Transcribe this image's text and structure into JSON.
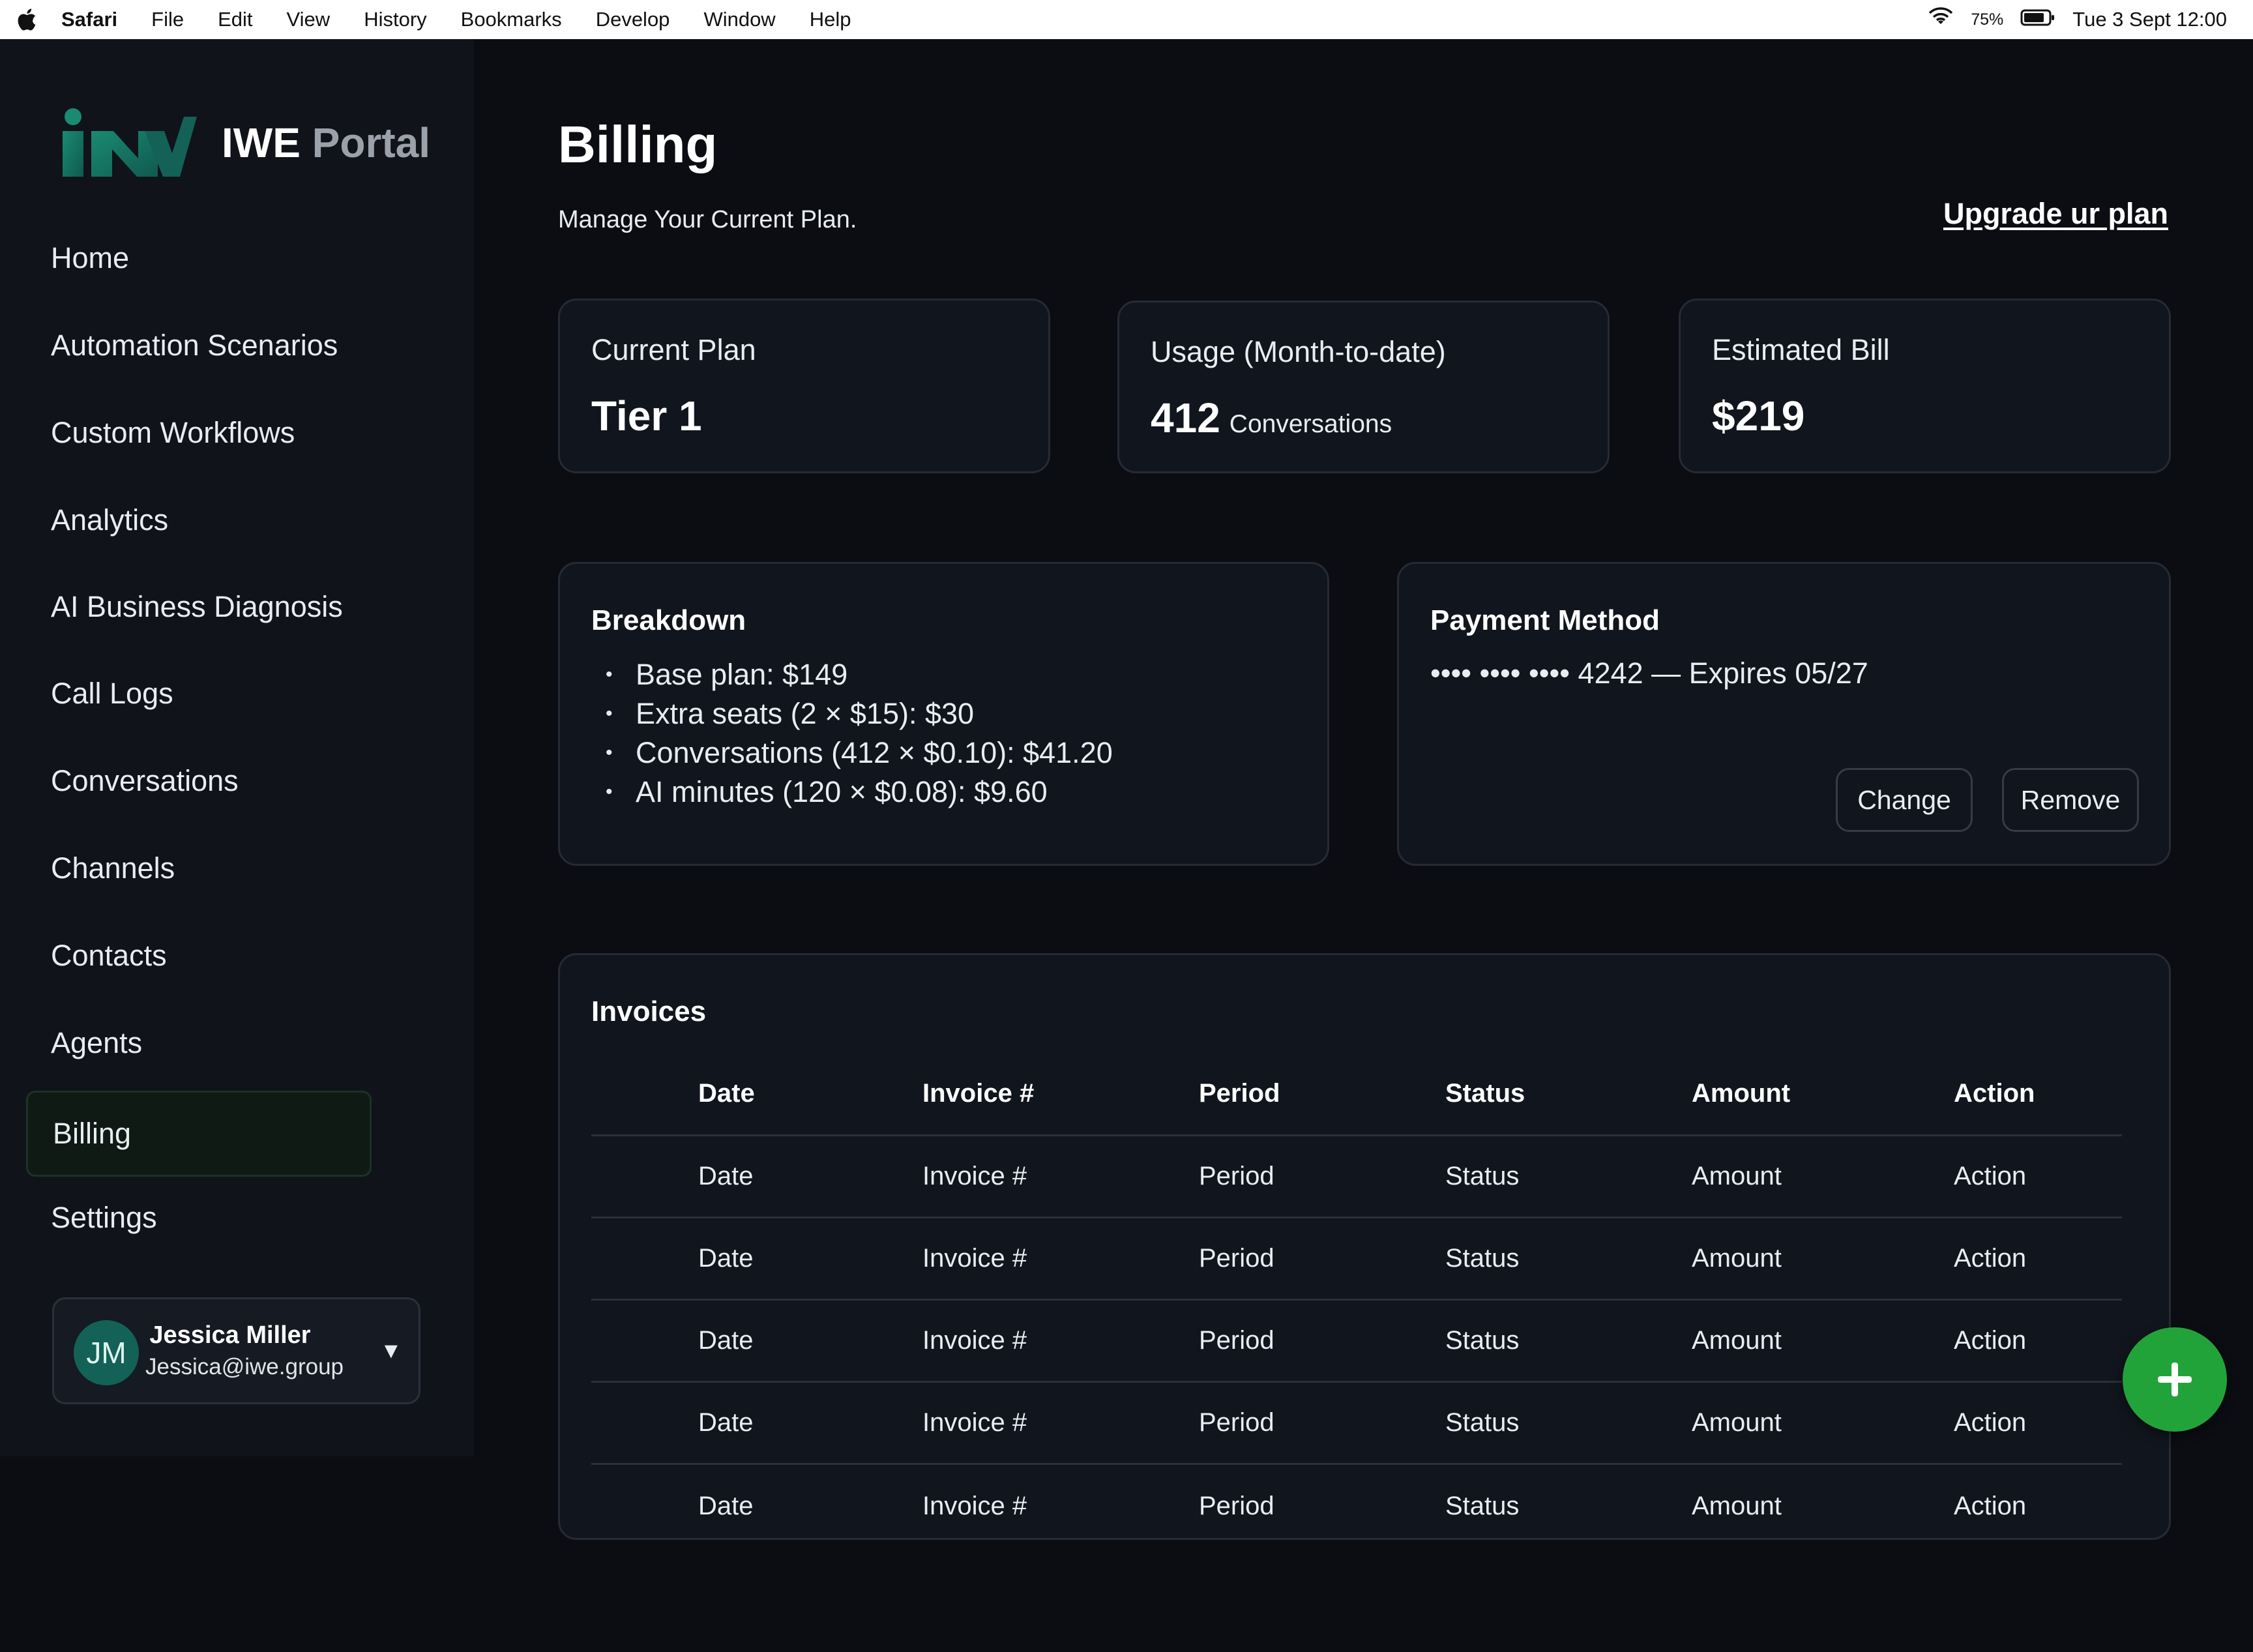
{
  "menubar": {
    "items": [
      "Safari",
      "File",
      "Edit",
      "View",
      "History",
      "Bookmarks",
      "Develop",
      "Window",
      "Help"
    ],
    "battery_percent": "75%",
    "datetime": "Tue 3 Sept  12:00"
  },
  "brand": {
    "name_part1": "IWE",
    "name_part2": "Portal",
    "accent_color": "#136157"
  },
  "sidebar": {
    "items": [
      {
        "label": "Home"
      },
      {
        "label": "Automation Scenarios"
      },
      {
        "label": "Custom Workflows"
      },
      {
        "label": "Analytics"
      },
      {
        "label": "AI Business Diagnosis"
      },
      {
        "label": "Call Logs"
      },
      {
        "label": "Conversations"
      },
      {
        "label": "Channels"
      },
      {
        "label": "Contacts"
      },
      {
        "label": "Agents"
      },
      {
        "label": "Billing"
      },
      {
        "label": "Settings"
      }
    ],
    "active": "Billing"
  },
  "user": {
    "initials": "JM",
    "name": "Jessica Miller",
    "email": "Jessica@iwe.group"
  },
  "page": {
    "title": "Billing",
    "subtitle": "Manage Your Current Plan.",
    "upgrade_link": "Upgrade ur plan"
  },
  "stats": {
    "plan": {
      "label": "Current Plan",
      "value": "Tier 1"
    },
    "usage": {
      "label": "Usage (Month-to-date)",
      "value": "412",
      "unit": "Conversations"
    },
    "bill": {
      "label": "Estimated Bill",
      "value": "$219"
    }
  },
  "breakdown": {
    "title": "Breakdown",
    "items": [
      "Base plan: $149",
      "Extra seats (2 × $15): $30",
      "Conversations (412 × $0.10): $41.20",
      "AI minutes (120 × $0.08): $9.60"
    ]
  },
  "payment": {
    "title": "Payment Method",
    "card": "•••• •••• •••• 4242 — Expires 05/27",
    "change_label": "Change",
    "remove_label": "Remove"
  },
  "invoices": {
    "title": "Invoices",
    "columns": [
      "Date",
      "Invoice #",
      "Period",
      "Status",
      "Amount",
      "Action"
    ],
    "rows": [
      [
        "Date",
        "Invoice #",
        "Period",
        "Status",
        "Amount",
        "Action"
      ],
      [
        "Date",
        "Invoice #",
        "Period",
        "Status",
        "Amount",
        "Action"
      ],
      [
        "Date",
        "Invoice #",
        "Period",
        "Status",
        "Amount",
        "Action"
      ],
      [
        "Date",
        "Invoice #",
        "Period",
        "Status",
        "Amount",
        "Action"
      ],
      [
        "Date",
        "Invoice #",
        "Period",
        "Status",
        "Amount",
        "Action"
      ]
    ]
  },
  "fab": {
    "icon": "plus-icon",
    "color": "#22a33a"
  }
}
